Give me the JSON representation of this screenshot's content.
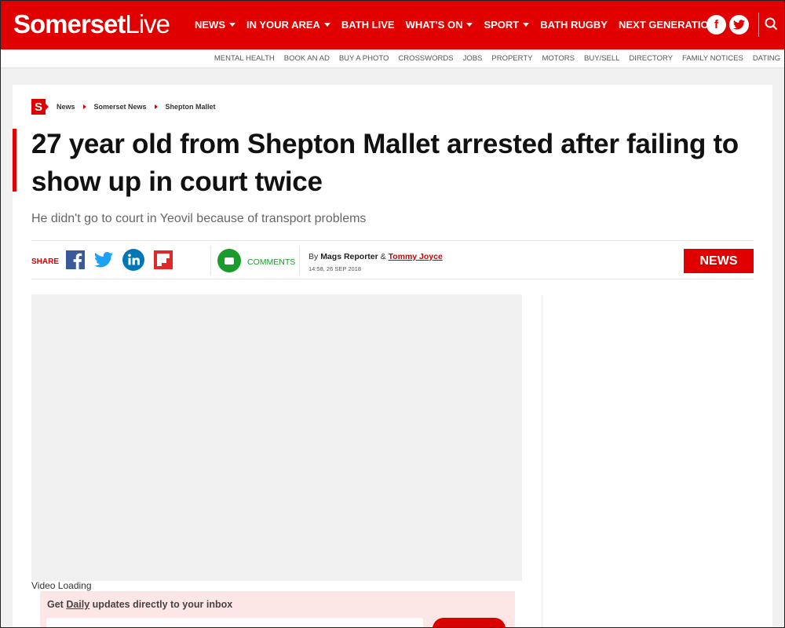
{
  "site": {
    "logo_bold": "Somerset",
    "logo_light": "Live"
  },
  "nav": {
    "items": [
      {
        "label": "NEWS",
        "dropdown": true
      },
      {
        "label": "IN YOUR AREA",
        "dropdown": true
      },
      {
        "label": "BATH LIVE",
        "dropdown": false
      },
      {
        "label": "WHAT'S ON",
        "dropdown": true
      },
      {
        "label": "SPORT",
        "dropdown": true
      },
      {
        "label": "BATH RUGBY",
        "dropdown": false
      },
      {
        "label": "NEXT GENERATION",
        "dropdown": false
      }
    ],
    "facebook_glyph": "f",
    "twitter_glyph": "t"
  },
  "subnav": {
    "items": [
      "MENTAL HEALTH",
      "BOOK AN AD",
      "BUY A PHOTO",
      "CROSSWORDS",
      "JOBS",
      "PROPERTY",
      "MOTORS",
      "BUY/SELL",
      "DIRECTORY",
      "FAMILY NOTICES",
      "DATING"
    ]
  },
  "breadcrumb": {
    "logo_letter": "S",
    "items": [
      "News",
      "Somerset News",
      "Shepton Mallet"
    ]
  },
  "article": {
    "headline": "27 year old from Shepton Mallet arrested after failing to show up in court twice",
    "standfirst": "He didn't go to court in Yeovil because of transport problems",
    "share_label": "SHARE",
    "comments_label": "COMMENTS",
    "byline_prefix": "By",
    "author_1": "Mags Reporter",
    "author_sep": "&",
    "author_2": "Tommy Joyce",
    "timestamp": "14:58, 26 SEP 2018",
    "category_badge": "NEWS",
    "video_status": "Video Loading"
  },
  "newsletter": {
    "text_1": "Get ",
    "text_daily": "Daily",
    "text_2": " updates directly to your inbox"
  },
  "colors": {
    "brand_red": "#e00000",
    "comments_green": "#1a9b2c",
    "facebook": "#3b5998",
    "twitter": "#1da1f2",
    "linkedin": "#0077b5",
    "flipboard": "#e12828"
  },
  "icons": [
    "facebook-icon",
    "twitter-icon",
    "linkedin-icon",
    "flipboard-icon",
    "search-icon",
    "comments-icon"
  ]
}
